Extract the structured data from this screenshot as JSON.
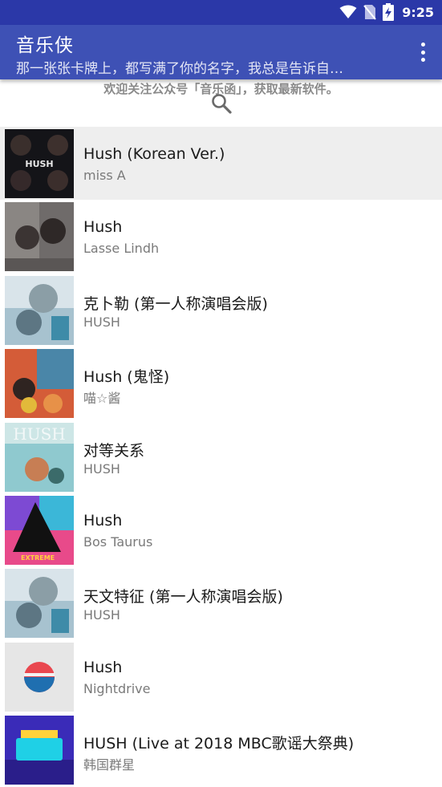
{
  "status_bar": {
    "time": "9:25",
    "icons": [
      "wifi-icon",
      "no-sim-icon",
      "battery-charging-icon"
    ]
  },
  "app_bar": {
    "title": "音乐侠",
    "subtitle": "那一张张卡牌上，都写满了你的名字，我总是告诉自…",
    "menu_icon": "more-vert-icon"
  },
  "notice": "欢迎关注公众号「音乐函」，获取最新软件。",
  "search_icon": "search-icon",
  "songs": [
    {
      "title": "Hush (Korean Ver.)",
      "artist": "miss A"
    },
    {
      "title": "Hush",
      "artist": "Lasse Lindh"
    },
    {
      "title": "克卜勒 (第一人称演唱会版)",
      "artist": "HUSH"
    },
    {
      "title": "Hush (鬼怪)",
      "artist": "喵☆酱"
    },
    {
      "title": "对等关系",
      "artist": "HUSH"
    },
    {
      "title": "Hush",
      "artist": "Bos Taurus"
    },
    {
      "title": "天文特征 (第一人称演唱会版)",
      "artist": "HUSH"
    },
    {
      "title": "Hush",
      "artist": "Nightdrive"
    },
    {
      "title": "HUSH (Live at 2018 MBC歌谣大祭典)",
      "artist": "韩国群星"
    }
  ],
  "selected_index": 0,
  "colors": {
    "status_bar": "#2b38a8",
    "app_bar": "#3e51b5",
    "selected_row": "#eeeeee"
  }
}
